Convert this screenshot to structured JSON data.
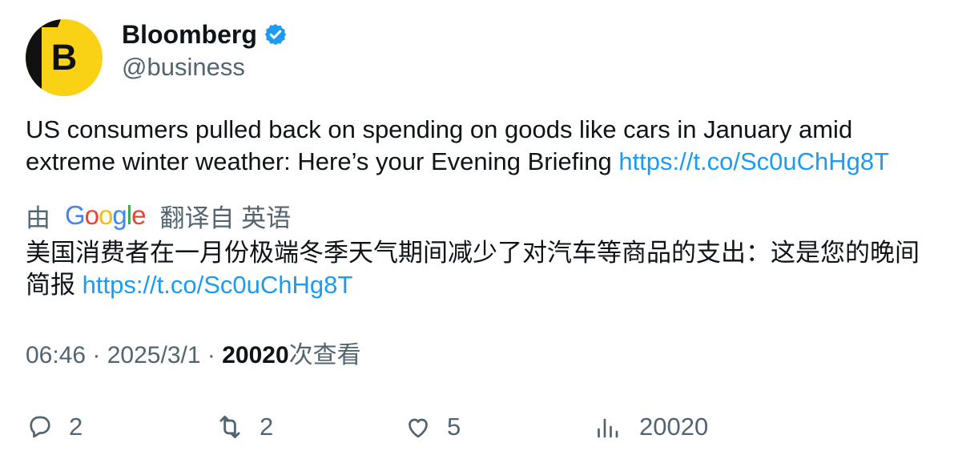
{
  "account": {
    "display_name": "Bloomberg",
    "handle": "@business",
    "avatar_letter": "B",
    "verified": true,
    "colors": {
      "avatar_yellow": "#f9d216",
      "avatar_black": "#111111",
      "verified_blue": "#1d9bf0"
    }
  },
  "tweet": {
    "text": "US consumers pulled back on spending on goods like cars in January amid extreme winter weather: Here’s your Evening Briefing ",
    "link": "https://t.co/Sc0uChHg8T"
  },
  "translation": {
    "prefix": "由",
    "provider": "Google",
    "suffix": "翻译自 英语",
    "text": "美国消费者在一月份极端冬季天气期间减少了对汽车等商品的支出：这是您的晚间简报 ",
    "link": "https://t.co/Sc0uChHg8T"
  },
  "meta": {
    "time": "06:46",
    "separator": " · ",
    "date": "2025/3/1",
    "views_count": "20020",
    "views_label": "次查看"
  },
  "actions": {
    "reply_count": "2",
    "retweet_count": "2",
    "like_count": "5",
    "views_count": "20020",
    "icons": [
      "reply-icon",
      "retweet-icon",
      "like-icon",
      "views-icon"
    ]
  }
}
